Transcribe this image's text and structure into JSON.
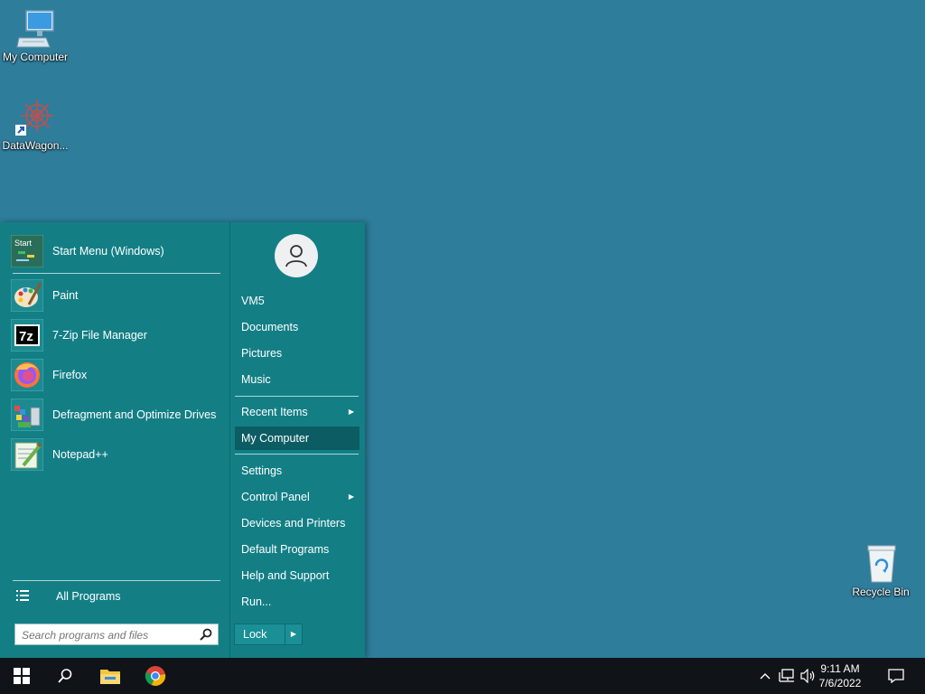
{
  "desktop": {
    "icons": [
      {
        "label": "My Computer"
      },
      {
        "label": "DataWagon..."
      },
      {
        "label": "Recycle Bin"
      }
    ]
  },
  "start_menu": {
    "programs": [
      {
        "label": "Start Menu (Windows)",
        "icon": "start-menu-icon"
      },
      {
        "label": "Paint",
        "icon": "paint-icon"
      },
      {
        "label": "7-Zip File Manager",
        "icon": "7zip-icon"
      },
      {
        "label": "Firefox",
        "icon": "firefox-icon"
      },
      {
        "label": "Defragment and Optimize Drives",
        "icon": "defrag-icon"
      },
      {
        "label": "Notepad++",
        "icon": "notepadpp-icon"
      }
    ],
    "start_icon_text": "Start",
    "sevenzip_icon_text": "7z",
    "all_programs": "All Programs",
    "search_placeholder": "Search programs and files",
    "right_links": {
      "user": "VM5",
      "documents": "Documents",
      "pictures": "Pictures",
      "music": "Music",
      "recent": "Recent Items",
      "computer": "My Computer",
      "settings": "Settings",
      "control_panel": "Control Panel",
      "devices": "Devices and Printers",
      "default_programs": "Default Programs",
      "help": "Help and Support",
      "run": "Run..."
    },
    "lock_label": "Lock",
    "selected_link": "My Computer"
  },
  "taskbar": {
    "time": "9:11 AM",
    "date": "7/6/2022",
    "pinned": [
      "start-button",
      "search-icon",
      "file-explorer-icon",
      "chrome-icon"
    ]
  },
  "colors": {
    "desktop": "#2e7d9b",
    "menu": "#137f85",
    "selected": "#0c5d63",
    "taskbar": "#101418"
  }
}
